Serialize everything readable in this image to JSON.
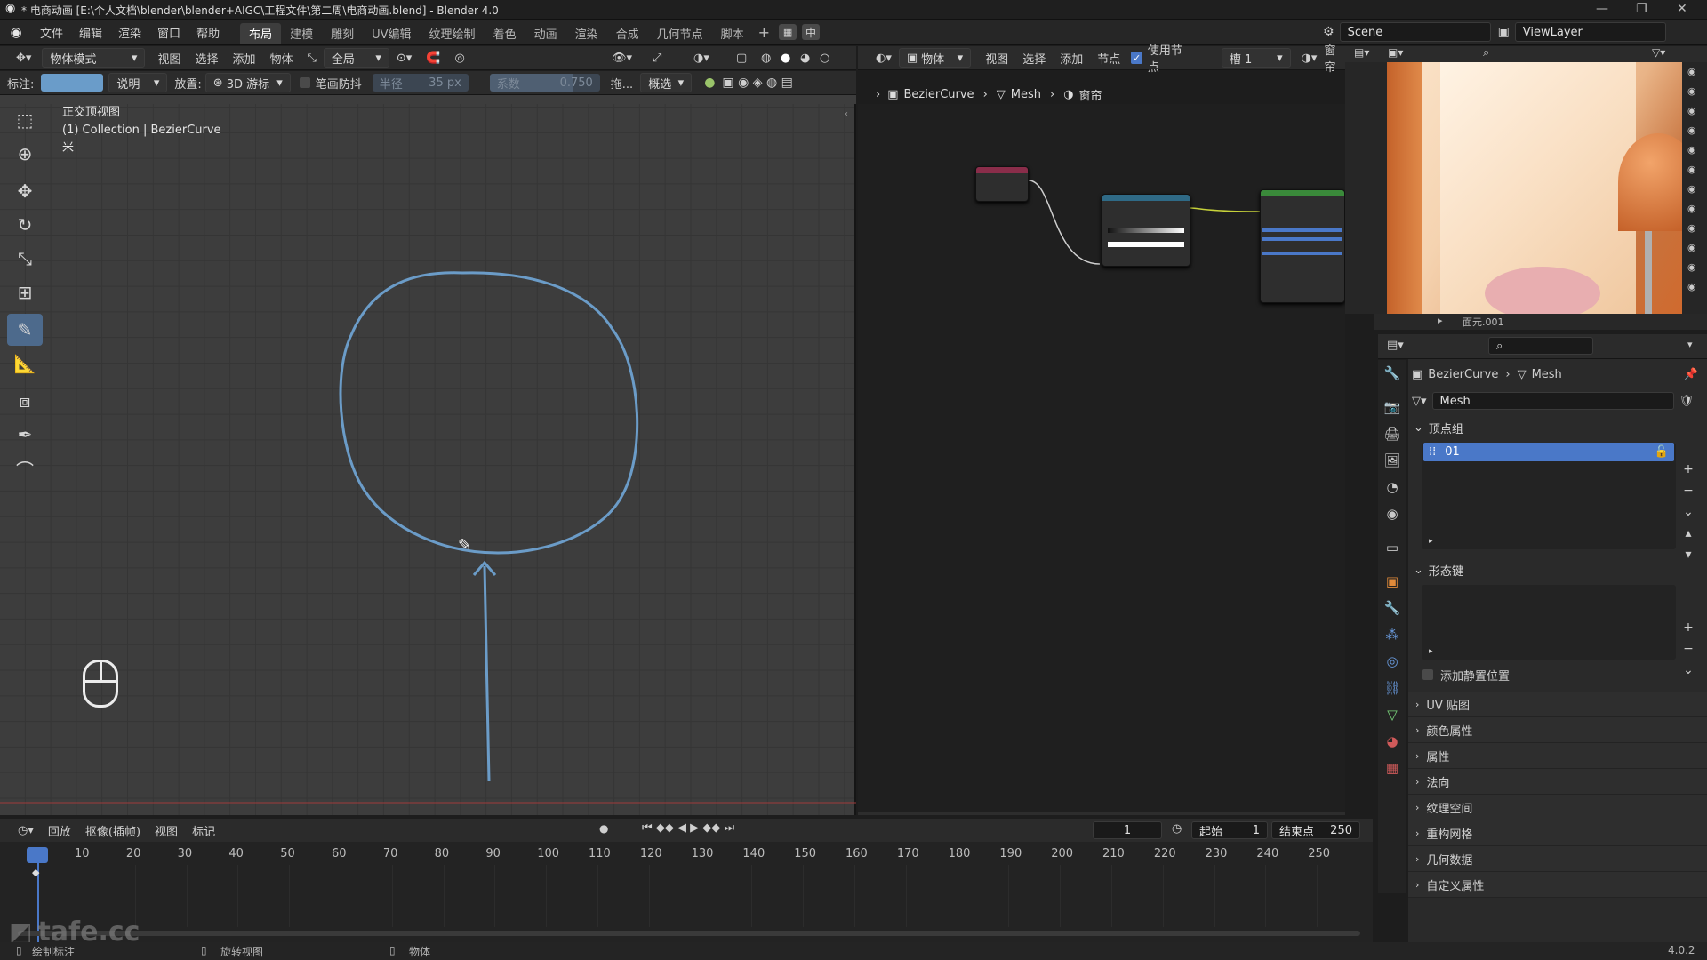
{
  "titlebar": {
    "title": "* 电商动画 [E:\\个人文档\\blender\\blender+AIGC\\工程文件\\第二周\\电商动画.blend] - Blender 4.0",
    "min": "—",
    "max": "❐",
    "close": "✕"
  },
  "menus": [
    "文件",
    "编辑",
    "渲染",
    "窗口",
    "帮助"
  ],
  "workspaces": [
    "布局",
    "建模",
    "雕刻",
    "UV编辑",
    "纹理绘制",
    "着色",
    "动画",
    "渲染",
    "合成",
    "几何节点",
    "脚本"
  ],
  "active_workspace": "布局",
  "lang_buttons": [
    "中"
  ],
  "scene": {
    "name": "Scene",
    "viewlayer": "ViewLayer"
  },
  "viewport_header": {
    "mode": "物体模式",
    "menus": [
      "视图",
      "选择",
      "添加",
      "物体"
    ],
    "orientation": "全局"
  },
  "tool_settings": {
    "annotate_label": "标注:",
    "placement_value": "说明",
    "placement_label": "放置:",
    "cursor_value": "3D 游标",
    "stabilize_label": "笔画防抖",
    "radius_label": "半径",
    "radius_value": "35 px",
    "factor_label": "系数",
    "factor_value": "0.750",
    "drag_label": "拖...",
    "select_value": "概选"
  },
  "viewport_overlay": {
    "view_name": "正交顶视图",
    "collection": "(1) Collection | BezierCurve",
    "unit": "米"
  },
  "node_header": {
    "object_dd": "物体",
    "menus": [
      "视图",
      "选择",
      "添加",
      "节点"
    ],
    "use_nodes": "使用节点",
    "slot": "槽 1",
    "window": "窗帘"
  },
  "node_breadcrumb": [
    "BezierCurve",
    "Mesh",
    "窗帘"
  ],
  "props": {
    "breadcrumb": [
      "BezierCurve",
      "Mesh"
    ],
    "mesh_name": "Mesh",
    "vertex_groups_label": "顶点组",
    "vertex_group_item": "01",
    "shape_keys_label": "形态键",
    "rest_position_label": "添加静置位置",
    "sections": [
      "UV 贴图",
      "颜色属性",
      "属性",
      "法向",
      "纹理空间",
      "重构网格",
      "几何数据",
      "自定义属性"
    ]
  },
  "outliner_peek": "面元.001",
  "timeline": {
    "menus": [
      "回放",
      "抠像(插帧)",
      "视图",
      "标记"
    ],
    "current_frame": "1",
    "start_label": "起始",
    "start_value": "1",
    "end_label": "结束点",
    "end_value": "250",
    "ticks": [
      "1",
      "10",
      "20",
      "30",
      "40",
      "50",
      "60",
      "70",
      "80",
      "90",
      "100",
      "110",
      "120",
      "130",
      "140",
      "150",
      "160",
      "170",
      "180",
      "190",
      "200",
      "210",
      "220",
      "230",
      "240",
      "250"
    ]
  },
  "status": {
    "left": "绘制标注",
    "middle": "旋转视图",
    "right": "物体",
    "version": "4.0.2"
  },
  "watermark": "tafe.cc",
  "colors": {
    "accent": "#4d6a8c",
    "stroke": "#6b9cc8",
    "active_item": "#4a78c8",
    "prop_active": "#78d27a"
  }
}
